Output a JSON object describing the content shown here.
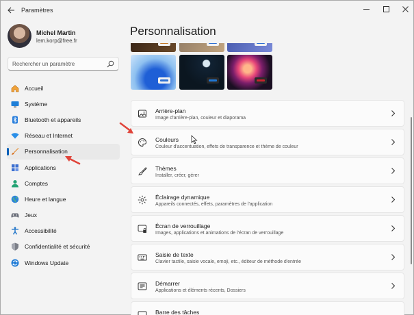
{
  "titlebar": {
    "title": "Paramètres"
  },
  "profile": {
    "name": "Michel Martin",
    "email": "lem.korp@free.fr"
  },
  "search": {
    "placeholder": "Rechercher un paramètre"
  },
  "nav": [
    {
      "label": "Accueil",
      "icon": "home-icon"
    },
    {
      "label": "Système",
      "icon": "system-icon"
    },
    {
      "label": "Bluetooth et appareils",
      "icon": "bluetooth-icon"
    },
    {
      "label": "Réseau et Internet",
      "icon": "network-icon"
    },
    {
      "label": "Personnalisation",
      "icon": "brush-icon",
      "selected": true
    },
    {
      "label": "Applications",
      "icon": "apps-icon"
    },
    {
      "label": "Comptes",
      "icon": "accounts-icon"
    },
    {
      "label": "Heure et langue",
      "icon": "time-language-icon"
    },
    {
      "label": "Jeux",
      "icon": "gaming-icon"
    },
    {
      "label": "Accessibilité",
      "icon": "accessibility-icon"
    },
    {
      "label": "Confidentialité et sécurité",
      "icon": "shield-icon"
    },
    {
      "label": "Windows Update",
      "icon": "update-icon"
    }
  ],
  "main": {
    "title": "Personnalisation",
    "cards": [
      {
        "title": "Arrière-plan",
        "subtitle": "Image d'arrière-plan, couleur et diaporama",
        "icon": "picture-icon"
      },
      {
        "title": "Couleurs",
        "subtitle": "Couleur d'accentuation, effets de transparence et thème de couleur",
        "icon": "palette-icon"
      },
      {
        "title": "Thèmes",
        "subtitle": "Installer, créer, gérer",
        "icon": "brush-icon"
      },
      {
        "title": "Éclairage dynamique",
        "subtitle": "Appareils connectés, effets, paramètres de l'application",
        "icon": "lighting-icon"
      },
      {
        "title": "Écran de verrouillage",
        "subtitle": "Images, applications et animations de l'écran de verrouillage",
        "icon": "lock-screen-icon"
      },
      {
        "title": "Saisie de texte",
        "subtitle": "Clavier tactile, saisie vocale, emoji, etc., éditeur de méthode d'entrée",
        "icon": "keyboard-icon"
      },
      {
        "title": "Démarrer",
        "subtitle": "Applications et éléments récents, Dossiers",
        "icon": "start-icon"
      },
      {
        "title": "Barre des tâches",
        "subtitle": "",
        "icon": "taskbar-icon"
      }
    ]
  },
  "colors": {
    "accent": "#005fb8",
    "red_arrow": "#e0443a"
  }
}
